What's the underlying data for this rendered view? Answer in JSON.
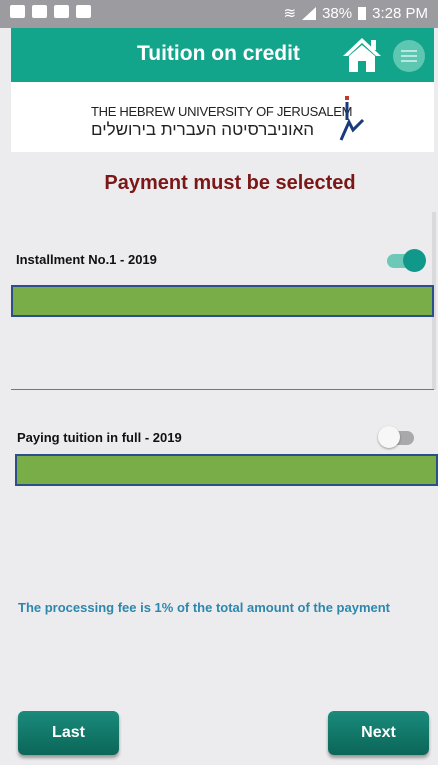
{
  "status_bar": {
    "battery": "38%",
    "time": "3:28 PM"
  },
  "app_bar": {
    "title": "Tuition on credit",
    "home_icon": "home-icon",
    "menu_icon": "menu-icon"
  },
  "logo": {
    "english": "THE HEBREW UNIVERSITY OF JERUSALEM",
    "hebrew": "האוניברסיטה העברית בירושלים"
  },
  "page": {
    "heading": "Payment must be selected"
  },
  "options": [
    {
      "label": "Installment No.1 -  2019",
      "selected": true
    },
    {
      "label": "Paying tuition in full - 2019",
      "selected": false
    }
  ],
  "fee_note": "The processing fee is 1% of the total amount of the payment",
  "buttons": {
    "last": "Last",
    "next": "Next"
  },
  "colors": {
    "accent": "#12a58c",
    "heading": "#7b1717",
    "note": "#2d87ad",
    "bar": "#78ad48"
  }
}
